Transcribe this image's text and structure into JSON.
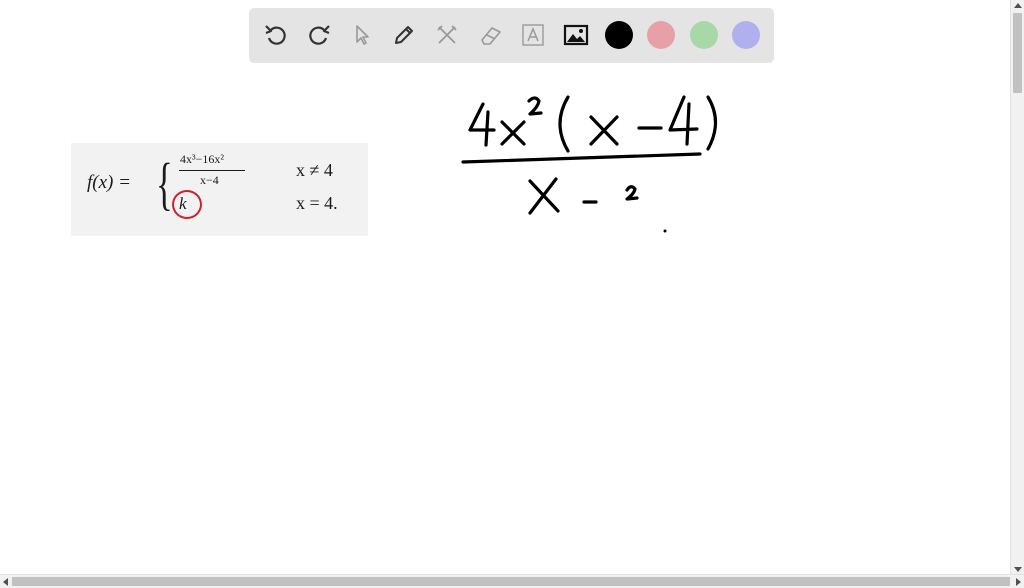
{
  "toolbar": {
    "tools": [
      {
        "name": "undo-icon"
      },
      {
        "name": "redo-icon"
      },
      {
        "name": "select-pointer-icon"
      },
      {
        "name": "pen-icon"
      },
      {
        "name": "tools-icon"
      },
      {
        "name": "eraser-icon"
      },
      {
        "name": "text-box-icon"
      },
      {
        "name": "image-icon"
      }
    ],
    "colors": [
      "#000000",
      "#e8a0a8",
      "#a8d8a8",
      "#b0b0ee"
    ]
  },
  "problem": {
    "function_label": "f(x) =",
    "numerator": "4x³−16x²",
    "denominator": "x−4",
    "case2_value": "k",
    "condition1": "x ≠ 4",
    "condition2": "x = 4."
  },
  "handwriting": {
    "numerator": "4x²(x − 4)",
    "denominator": "x − 2"
  }
}
